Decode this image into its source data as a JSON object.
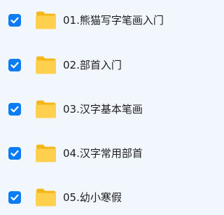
{
  "colors": {
    "background": "#f2f7fe",
    "checkbox": "#0b7cf3",
    "folder_back": "#f5b619",
    "folder_front": "#ffd04d",
    "text": "#1d1d1f"
  },
  "files": [
    {
      "name": "01.熊猫写字笔画入门",
      "selected": true,
      "icon": "folder-icon"
    },
    {
      "name": "02.部首入门",
      "selected": true,
      "icon": "folder-icon"
    },
    {
      "name": "03.汉字基本笔画",
      "selected": true,
      "icon": "folder-icon"
    },
    {
      "name": "04.汉字常用部首",
      "selected": true,
      "icon": "folder-icon"
    },
    {
      "name": "05.幼小寒假",
      "selected": true,
      "icon": "folder-icon"
    }
  ]
}
